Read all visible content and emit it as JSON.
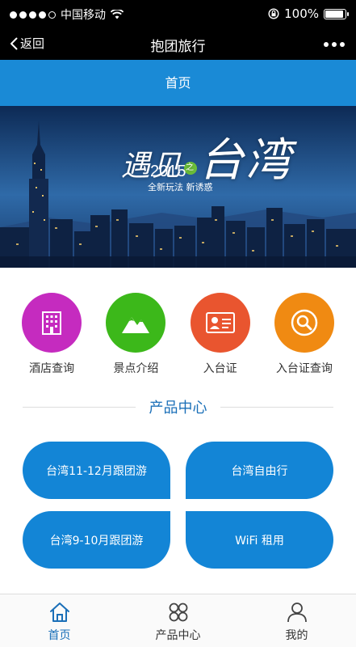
{
  "status_bar": {
    "carrier": "中国移动",
    "time": "",
    "battery_percent": "100%",
    "battery_level": 1.0
  },
  "nav": {
    "back_label": "返回",
    "title": "抱团旅行"
  },
  "page": {
    "header_title": "首页"
  },
  "banner": {
    "title_part1": "遇见",
    "title_connector": "之",
    "title_part2": "台湾",
    "year": "2015",
    "subtitle": "全新玩法 新诱惑"
  },
  "quick_actions": [
    {
      "label": "酒店查询",
      "icon": "hotel-icon",
      "color": "#c52bbf"
    },
    {
      "label": "景点介绍",
      "icon": "mountain-icon",
      "color": "#3cb81a"
    },
    {
      "label": "入台证",
      "icon": "id-card-icon",
      "color": "#e9552f"
    },
    {
      "label": "入台证查询",
      "icon": "search-icon",
      "color": "#f08a12"
    }
  ],
  "products": {
    "section_title": "产品中心",
    "items": [
      {
        "label": "台湾11-12月跟团游"
      },
      {
        "label": "台湾自由行"
      },
      {
        "label": "台湾9-10月跟团游"
      },
      {
        "label": "WiFi 租用"
      }
    ]
  },
  "tab_bar": {
    "tabs": [
      {
        "label": "首页",
        "icon": "home-icon",
        "active": true
      },
      {
        "label": "产品中心",
        "icon": "grid-icon",
        "active": false
      },
      {
        "label": "我的",
        "icon": "user-icon",
        "active": false
      }
    ]
  },
  "colors": {
    "accent": "#1a8ad6",
    "product_button": "#1385d6",
    "active_tab": "#1a6fb8"
  }
}
